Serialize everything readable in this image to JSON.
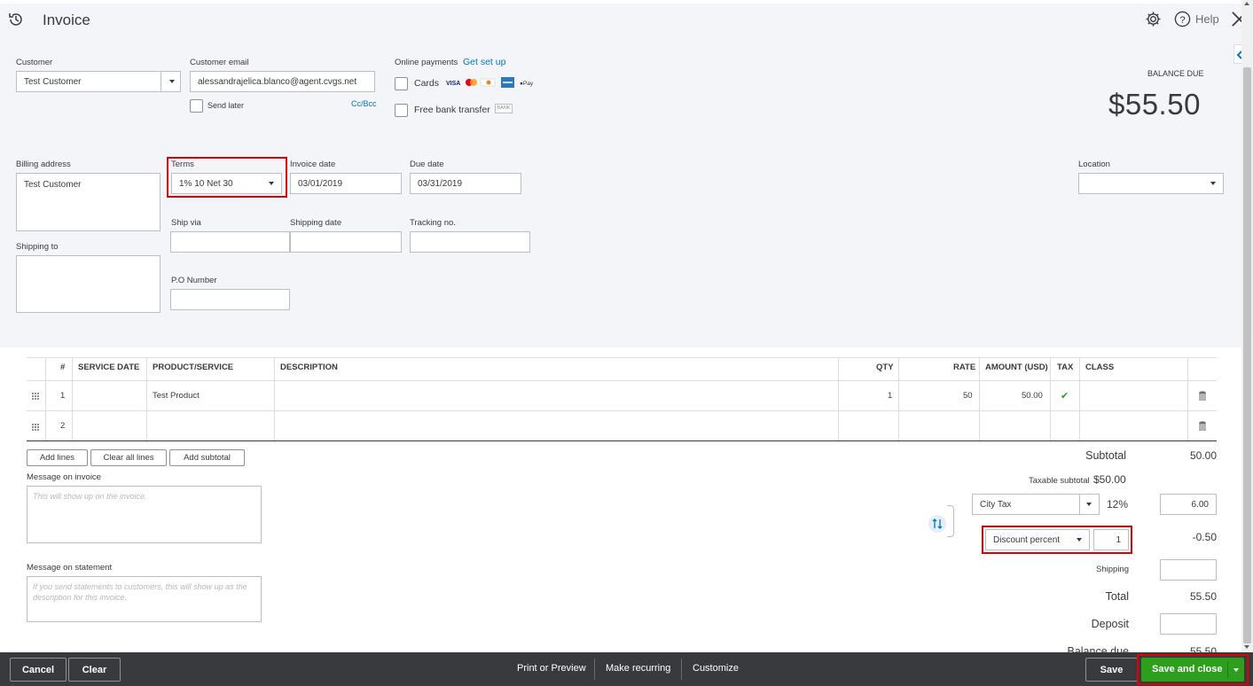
{
  "header": {
    "title": "Invoice",
    "help": "Help"
  },
  "customer": {
    "label": "Customer",
    "value": "Test Customer"
  },
  "email": {
    "label": "Customer email",
    "value": "alessandrajelica.blanco@agent.cvgs.net",
    "send_later": "Send later",
    "cc_bcc": "Cc/Bcc"
  },
  "online_payments": {
    "label": "Online payments",
    "link": "Get set up",
    "cards": "Cards",
    "bank": "Free bank transfer",
    "bank_badge": "BANK",
    "card_brands": [
      "VISA",
      "mastercard",
      "discover",
      "amex",
      "Apple Pay"
    ]
  },
  "balance": {
    "label": "BALANCE DUE",
    "amount": "$55.50"
  },
  "billing": {
    "label": "Billing address",
    "value": "Test Customer",
    "shipping_label": "Shipping to"
  },
  "terms": {
    "label": "Terms",
    "value": "1% 10 Net 30"
  },
  "invoice_date": {
    "label": "Invoice date",
    "value": "03/01/2019"
  },
  "due_date": {
    "label": "Due date",
    "value": "03/31/2019"
  },
  "location": {
    "label": "Location",
    "value": ""
  },
  "ship_via": {
    "label": "Ship via"
  },
  "shipping_date": {
    "label": "Shipping date"
  },
  "tracking": {
    "label": "Tracking no."
  },
  "po": {
    "label": "P.O Number"
  },
  "table": {
    "headers": [
      "#",
      "SERVICE DATE",
      "PRODUCT/SERVICE",
      "DESCRIPTION",
      "QTY",
      "RATE",
      "AMOUNT (USD)",
      "TAX",
      "CLASS"
    ],
    "rows": [
      {
        "num": "1",
        "service_date": "",
        "product": "Test Product",
        "description": "",
        "qty": "1",
        "rate": "50",
        "amount": "50.00",
        "tax": "✔",
        "class": ""
      },
      {
        "num": "2",
        "service_date": "",
        "product": "",
        "description": "",
        "qty": "",
        "rate": "",
        "amount": "",
        "tax": "",
        "class": ""
      }
    ]
  },
  "line_buttons": {
    "add_lines": "Add lines",
    "clear_all": "Clear all lines",
    "add_subtotal": "Add subtotal"
  },
  "message_invoice": {
    "label": "Message on invoice",
    "placeholder": "This will show up on the invoice."
  },
  "message_statement": {
    "label": "Message on statement",
    "placeholder": "If you send statements to customers, this will show up as the description for this invoice."
  },
  "totals": {
    "subtotal_label": "Subtotal",
    "subtotal": "50.00",
    "taxable_label": "Taxable subtotal",
    "taxable": "$50.00",
    "tax_name": "City Tax",
    "tax_rate": "12%",
    "tax_amount": "6.00",
    "discount_type": "Discount percent",
    "discount_value": "1",
    "discount_amount": "-0.50",
    "shipping_label": "Shipping",
    "total_label": "Total",
    "total": "55.50",
    "deposit_label": "Deposit",
    "balance_due_label": "Balance due",
    "balance_due": "55.50"
  },
  "footer": {
    "cancel": "Cancel",
    "clear": "Clear",
    "print": "Print or Preview",
    "recurring": "Make recurring",
    "customize": "Customize",
    "save": "Save",
    "save_close": "Save and close"
  }
}
